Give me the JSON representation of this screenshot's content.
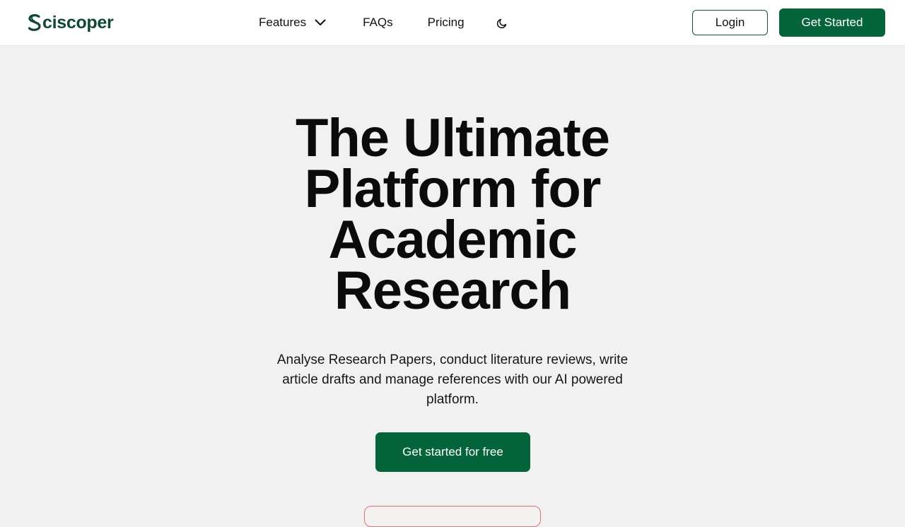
{
  "brand": {
    "name": "Sciscoper",
    "color": "#0e4a32",
    "icon": "logo-s-icon"
  },
  "nav": {
    "features_label": "Features",
    "faqs_label": "FAQs",
    "pricing_label": "Pricing",
    "features_icon": "chevron-down-icon",
    "theme_icon": "moon-icon"
  },
  "header_actions": {
    "login_label": "Login",
    "get_started_label": "Get Started"
  },
  "hero": {
    "title_lines": [
      "The Ultimate",
      "Platform for",
      "Academic",
      "Research"
    ],
    "subtitle": "Analyse Research Papers, conduct literature reviews, write article drafts and manage references with our AI powered platform.",
    "cta_label": "Get started for free"
  },
  "colors": {
    "accent": "#04653a",
    "background": "#f1f1f2",
    "badge_border": "#e0717a"
  }
}
